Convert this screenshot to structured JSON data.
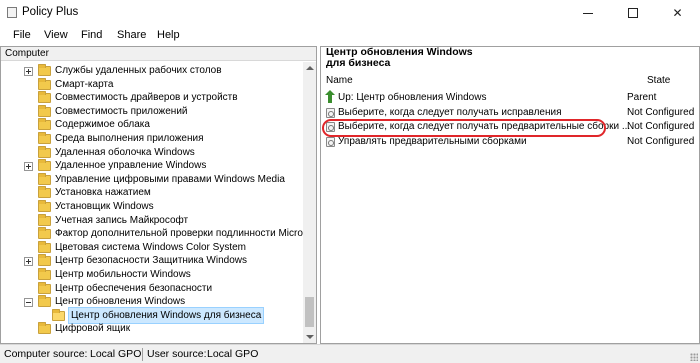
{
  "window": {
    "title": "Policy Plus"
  },
  "menu": [
    "File",
    "View",
    "Find",
    "Share",
    "Help"
  ],
  "left": {
    "header": "Computer",
    "tree": [
      {
        "label": "Службы удаленных рабочих столов",
        "expander": "plus",
        "indent": 0
      },
      {
        "label": "Смарт-карта",
        "expander": "",
        "indent": 0
      },
      {
        "label": "Совместимость драйверов и устройств",
        "expander": "",
        "indent": 0
      },
      {
        "label": "Совместимость приложений",
        "expander": "",
        "indent": 0
      },
      {
        "label": "Содержимое облака",
        "expander": "",
        "indent": 0
      },
      {
        "label": "Среда выполнения приложения",
        "expander": "",
        "indent": 0
      },
      {
        "label": "Удаленная оболочка Windows",
        "expander": "",
        "indent": 0
      },
      {
        "label": "Удаленное управление Windows",
        "expander": "plus",
        "indent": 0
      },
      {
        "label": "Управление цифровыми правами Windows Media",
        "expander": "",
        "indent": 0
      },
      {
        "label": "Установка нажатием",
        "expander": "",
        "indent": 0
      },
      {
        "label": "Установщик Windows",
        "expander": "",
        "indent": 0
      },
      {
        "label": "Учетная запись Майкрософт",
        "expander": "",
        "indent": 0
      },
      {
        "label": "Фактор дополнительной проверки подлинности Microsoft",
        "expander": "",
        "indent": 0
      },
      {
        "label": "Цветовая система Windows Color System",
        "expander": "",
        "indent": 0
      },
      {
        "label": "Центр безопасности Защитника Windows",
        "expander": "plus",
        "indent": 0
      },
      {
        "label": "Центр мобильности Windows",
        "expander": "",
        "indent": 0
      },
      {
        "label": "Центр обеспечения безопасности",
        "expander": "",
        "indent": 0
      },
      {
        "label": "Центр обновления Windows",
        "expander": "minus",
        "indent": 0
      },
      {
        "label": "Центр обновления Windows для бизнеса",
        "expander": "",
        "indent": 1,
        "selected": true
      },
      {
        "label": "Цифровой ящик",
        "expander": "",
        "indent": 0
      }
    ]
  },
  "right": {
    "title": "Центр обновления Windows для бизнеса",
    "col_name": "Name",
    "col_state": "State",
    "rows": [
      {
        "icon": "up-arrow-icon",
        "name": "Up: Центр обновления Windows",
        "state": "Parent"
      },
      {
        "icon": "policy-setting-icon",
        "name": "Выберите, когда следует получать исправления",
        "state": "Not Configured"
      },
      {
        "icon": "policy-setting-icon",
        "name": "Выберите, когда следует получать предварительные сборки ...",
        "state": "Not Configured"
      },
      {
        "icon": "policy-setting-icon",
        "name": "Управлять предварительными сборками",
        "state": "Not Configured"
      }
    ],
    "highlight_color": "#e0262a"
  },
  "status": {
    "computer_label": "Computer source:",
    "computer_value": "Local GPO",
    "user_label": "User source:",
    "user_value": "Local GPO"
  }
}
